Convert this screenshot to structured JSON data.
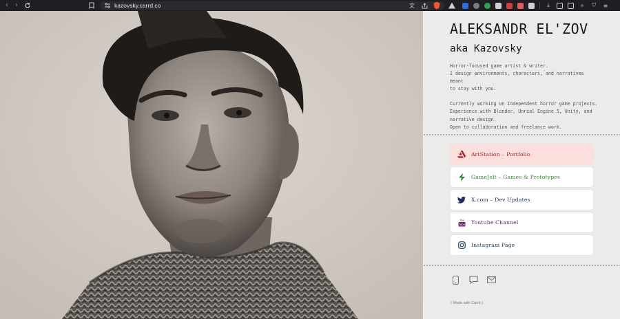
{
  "browser": {
    "url": "kazovsky.carrd.co",
    "icons": [
      "back-icon",
      "forward-icon",
      "reload-icon",
      "bookmark-icon",
      "tune-icon",
      "translate-icon",
      "share-icon",
      "brave-shields-icon",
      "brave-rewards-icon",
      "extensions-icon",
      "download-icon",
      "sidebar-icon",
      "wallet-icon",
      "vpn-icon",
      "menu-icon"
    ]
  },
  "profile": {
    "name": "ALEKSANDR EL'ZOV",
    "alias": "aka Kazovsky",
    "bio_lines": [
      "Horror-focused game artist & writer.",
      "I design environments, characters, and narratives meant",
      "to stay with you."
    ],
    "work_lines": [
      "Currently working on independent horror game projects.",
      "Experience with Blender, Unreal Engine 5, Unity, and",
      "narrative design.",
      "Open to collaboration and freelance work."
    ]
  },
  "links": [
    {
      "label": "ArtStation – Portfolio",
      "icon": "artstation-icon",
      "color": "#b3262b",
      "bg": "#fde0dd"
    },
    {
      "label": "GameJolt – Games & Prototypes",
      "icon": "gamejolt-icon",
      "color": "#2f8a2a",
      "bg": "#ffffff"
    },
    {
      "label": "X.com – Dev Updates",
      "icon": "x-twitter-icon",
      "color": "#1d2a6b",
      "bg": "#ffffff"
    },
    {
      "label": "Youtube Channel",
      "icon": "youtube-icon",
      "color": "#6b1d6b",
      "bg": "#ffffff"
    },
    {
      "label": "Instagram Page",
      "icon": "instagram-icon",
      "color": "#23465e",
      "bg": "#ffffff"
    }
  ],
  "social_icons": [
    "phone-icon",
    "message-icon",
    "email-icon"
  ],
  "footer": {
    "made_with": "( Made with Carrd )"
  },
  "colors": {
    "panel_bg": "#ecebe9",
    "photo_tone": "#d2ccc6"
  }
}
